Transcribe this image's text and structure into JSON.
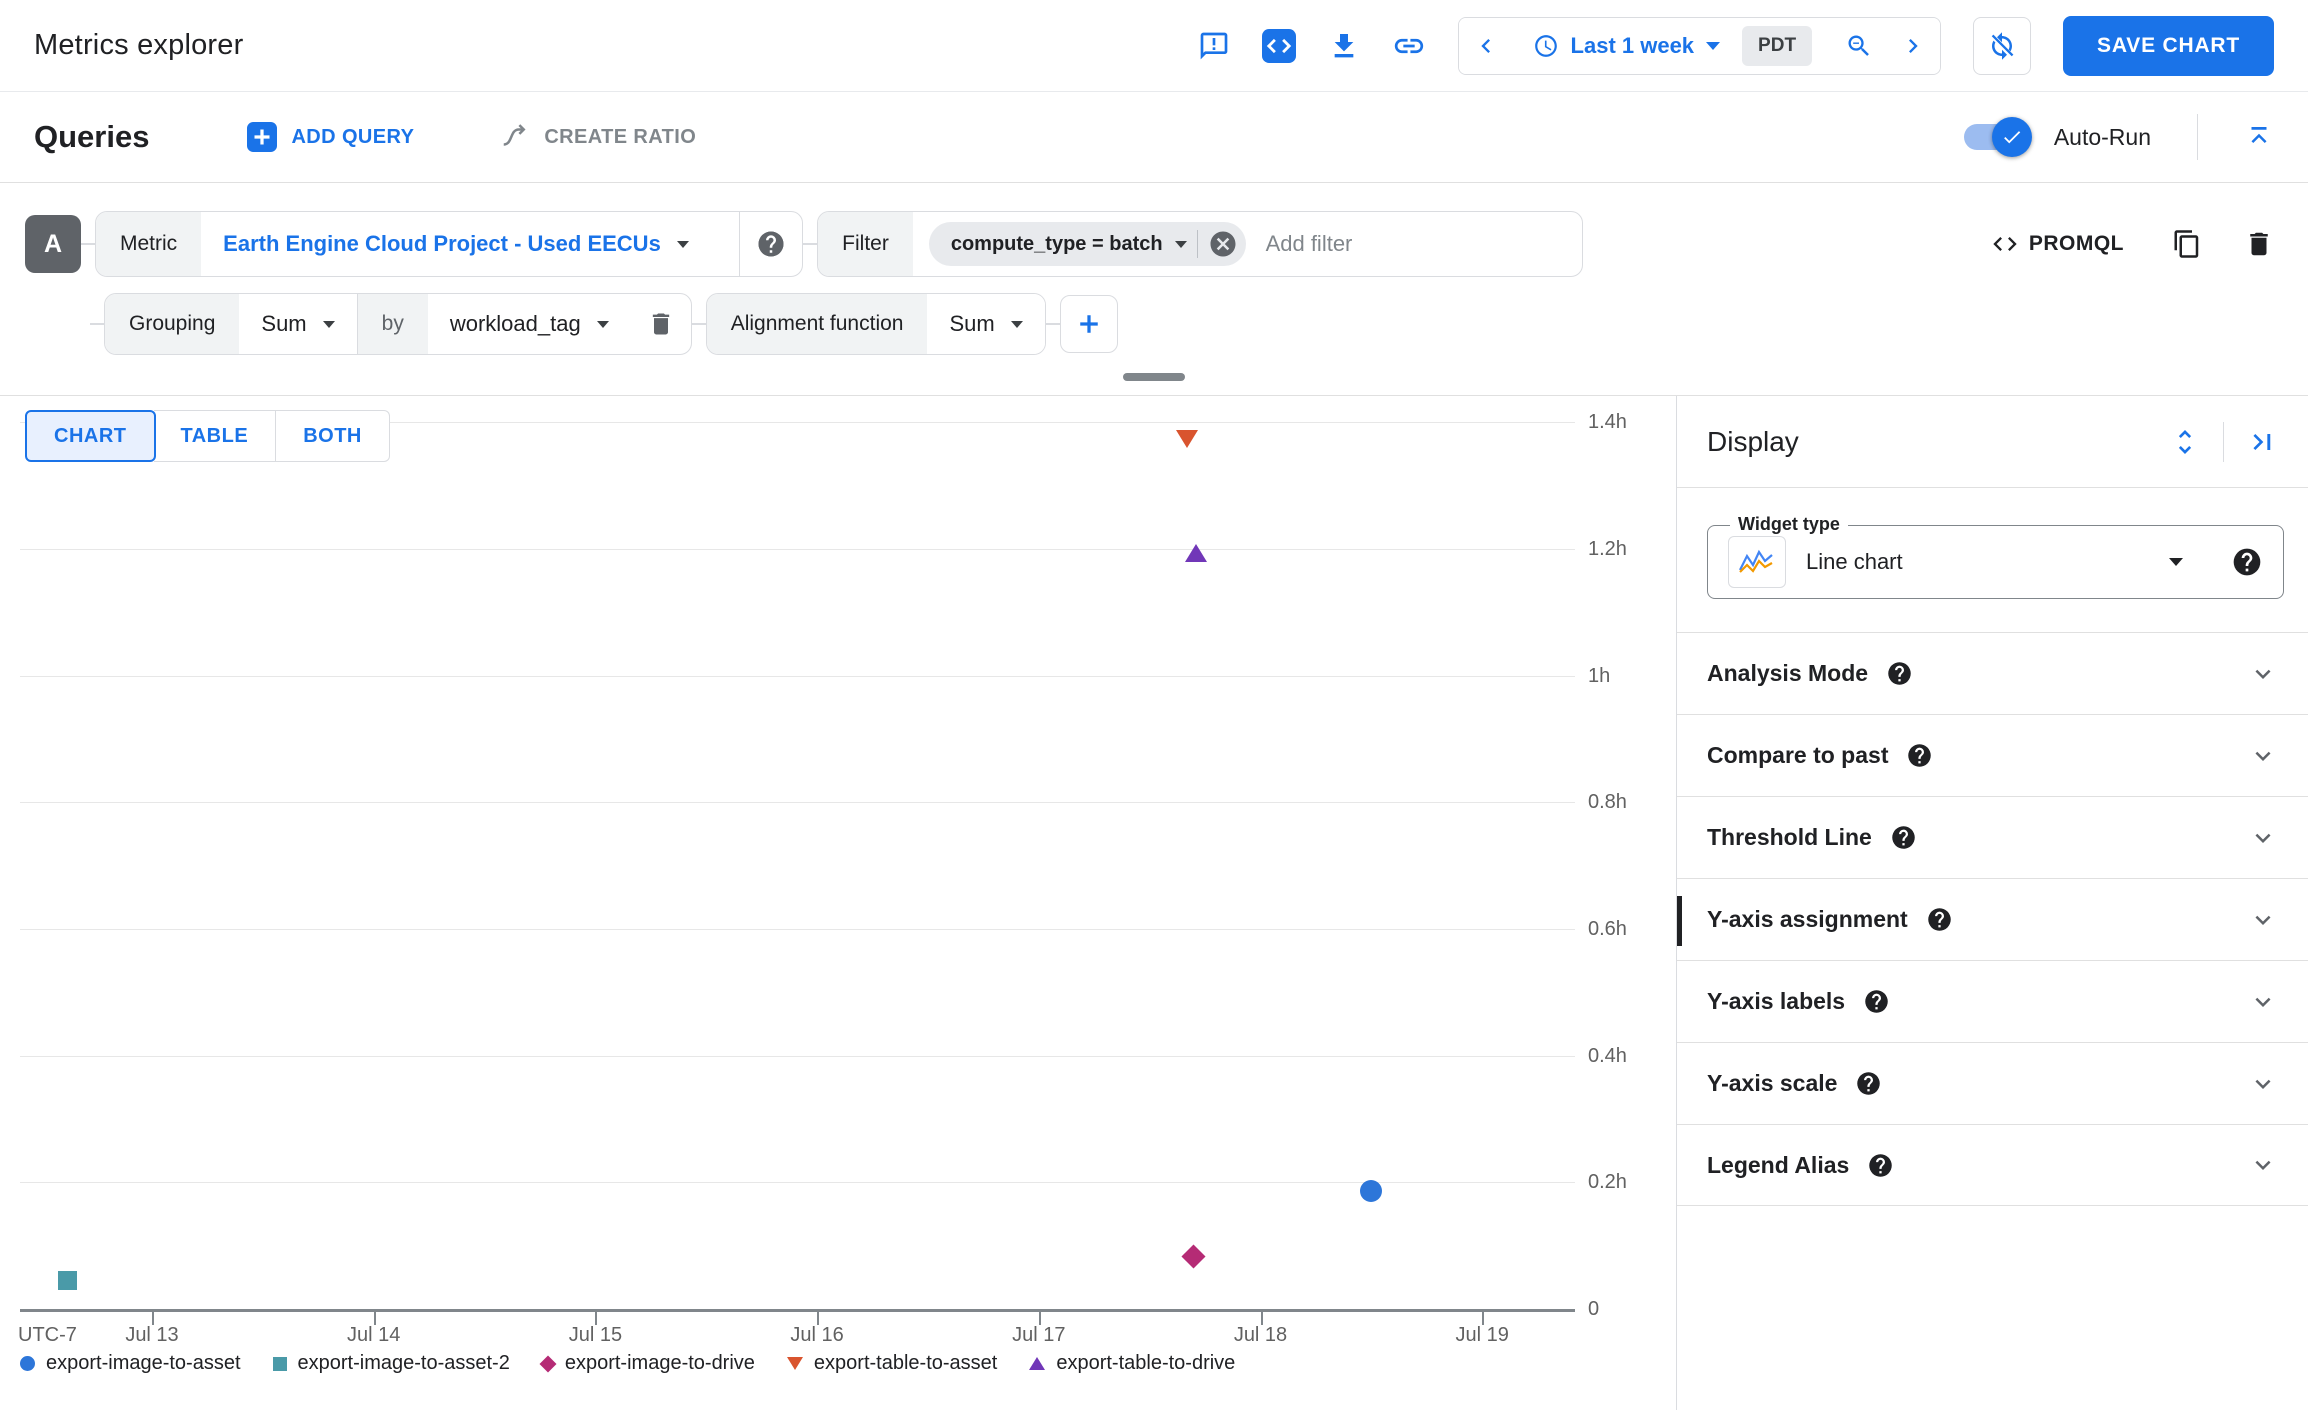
{
  "header": {
    "title": "Metrics explorer",
    "time_range": {
      "label": "Last 1 week",
      "timezone": "PDT"
    },
    "save_button": "SAVE CHART",
    "icons": [
      "feedback-icon",
      "code-icon",
      "download-icon",
      "link-icon",
      "clock-icon",
      "zoom-out-icon",
      "auto-refresh-off-icon"
    ]
  },
  "queries_bar": {
    "heading": "Queries",
    "add_query": "ADD QUERY",
    "create_ratio": "CREATE RATIO",
    "autorun_label": "Auto-Run"
  },
  "query_builder": {
    "query_letter": "A",
    "metric_label": "Metric",
    "metric_value": "Earth Engine Cloud Project - Used EECUs",
    "filter_label": "Filter",
    "filter_chip": "compute_type = batch",
    "add_filter_placeholder": "Add filter",
    "promql_label": "PROMQL",
    "grouping_label": "Grouping",
    "grouping_value": "Sum",
    "by_label": "by",
    "group_by_value": "workload_tag",
    "alignment_label": "Alignment function",
    "alignment_value": "Sum"
  },
  "view_tabs": [
    "CHART",
    "TABLE",
    "BOTH"
  ],
  "chart_data": {
    "type": "scatter",
    "title": "",
    "grid": true,
    "legend_position": "bottom",
    "x_axis": {
      "timezone_label": "UTC-7",
      "tick_labels": [
        "Jul 13",
        "Jul 14",
        "Jul 15",
        "Jul 16",
        "Jul 17",
        "Jul 18",
        "Jul 19"
      ]
    },
    "y_axis": {
      "unit": "hours",
      "range": [
        0,
        1.47
      ],
      "ticks": [
        {
          "label": "1.4h",
          "value": 1.4
        },
        {
          "label": "1.2h",
          "value": 1.2
        },
        {
          "label": "1h",
          "value": 1.0
        },
        {
          "label": "0.8h",
          "value": 0.8
        },
        {
          "label": "0.6h",
          "value": 0.6
        },
        {
          "label": "0.4h",
          "value": 0.4
        },
        {
          "label": "0.2h",
          "value": 0.2
        },
        {
          "label": "0",
          "value": 0
        }
      ]
    },
    "series": [
      {
        "name": "export-image-to-asset",
        "marker": "circle",
        "color": "#2d76d9",
        "points": [
          {
            "x_label": "Jul 18 ~12:00",
            "day_offset_from_jul13": 5.5,
            "value_hours": 0.19
          }
        ]
      },
      {
        "name": "export-image-to-asset-2",
        "marker": "square",
        "color": "#4a9aa8",
        "points": [
          {
            "x_label": "Jul 12 ~15:00",
            "day_offset_from_jul13": -0.38,
            "value_hours": 0.05
          }
        ]
      },
      {
        "name": "export-image-to-drive",
        "marker": "diamond",
        "color": "#b52b75",
        "points": [
          {
            "x_label": "Jul 17 ~17:00",
            "day_offset_from_jul13": 4.7,
            "value_hours": 0.09
          }
        ]
      },
      {
        "name": "export-table-to-asset",
        "marker": "triangle-down",
        "color": "#d9542e",
        "points": [
          {
            "x_label": "Jul 17 ~16:00",
            "day_offset_from_jul13": 4.67,
            "value_hours": 1.38
          }
        ]
      },
      {
        "name": "export-table-to-drive",
        "marker": "triangle-up",
        "color": "#7137b8",
        "points": [
          {
            "x_label": "Jul 17 ~17:00",
            "day_offset_from_jul13": 4.71,
            "value_hours": 1.2
          }
        ]
      }
    ]
  },
  "display_panel": {
    "title": "Display",
    "widget_type_label": "Widget type",
    "widget_type_value": "Line chart",
    "sections": [
      "Analysis Mode",
      "Compare to past",
      "Threshold Line",
      "Y-axis assignment",
      "Y-axis labels",
      "Y-axis scale",
      "Legend Alias"
    ]
  },
  "colors": {
    "accent_blue": "#1a73e8",
    "axis_gray": "#80868b",
    "label_gray": "#616161"
  }
}
